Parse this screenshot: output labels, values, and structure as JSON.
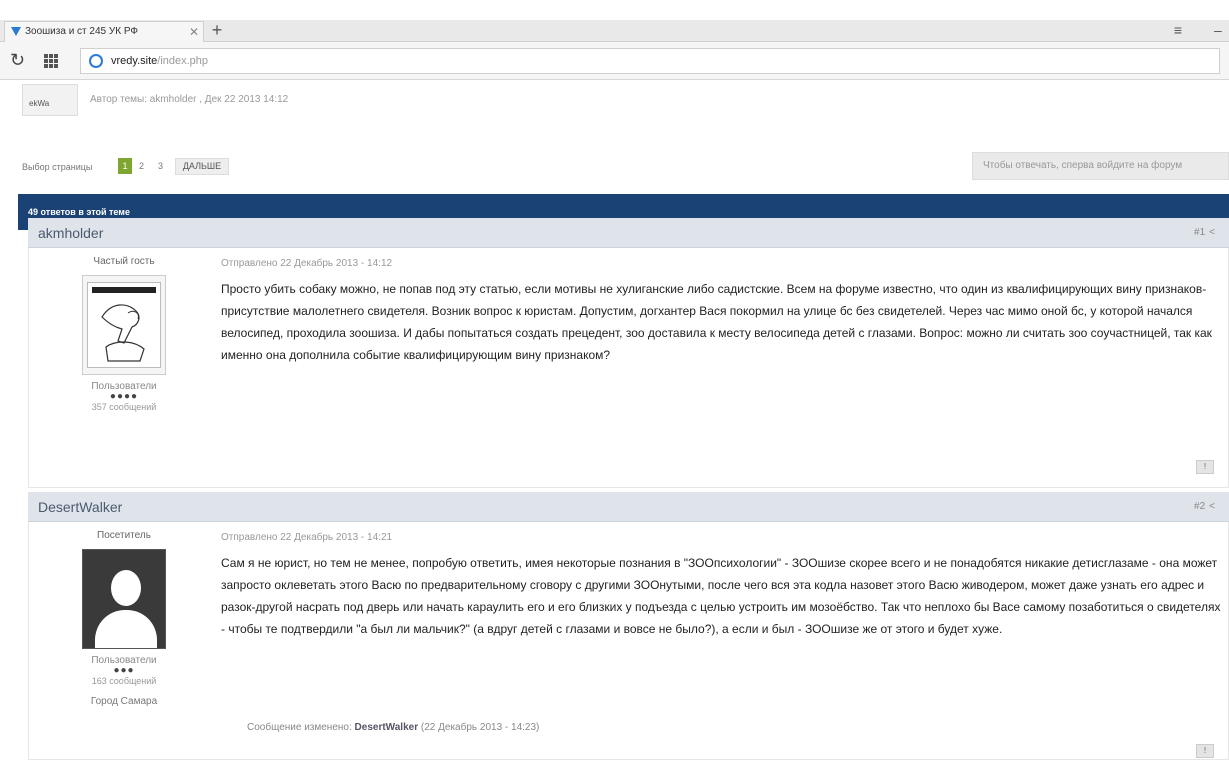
{
  "browser": {
    "tab_title": "Зоошиза и ст 245 УК РФ",
    "tab_close": "✕",
    "new_tab": "+",
    "menu_icon": "≡",
    "url_site": "vredy.site",
    "url_path": "/index.php"
  },
  "topic": {
    "author_line": "Автор темы: akmholder , Дек 22 2013 14:12"
  },
  "pager": {
    "label": "Выбор страницы",
    "pages": [
      "1",
      "2",
      "3"
    ],
    "next_label": "ДАЛЬШЕ",
    "login_hint": "Чтобы отвечать, сперва войдите на форум"
  },
  "replies_bar": "49 ответов в этой теме",
  "posts": [
    {
      "author": "akmholder",
      "number": "#1",
      "rank_title": "Частый гость",
      "group": "Пользователи",
      "pips": "●●●●",
      "post_count": "357 сообщений",
      "date": "Отправлено 22 Декабрь 2013 - 14:12",
      "text": "Просто убить собаку можно, не попав под эту статью, если мотивы не хулиганские либо садистские. Всем на форуме известно, что один из квалифицирующих вину признаков- присутствие малолетнего свидетеля. Возник вопрос к юристам. Допустим, догхантер Вася покормил на улице бс без свидетелей. Через час мимо оной бс, у которой начался велосипед, проходила зоошиза. И дабы попытаться создать прецедент, зоо доставила к месту велосипеда детей с глазами. Вопрос: можно ли считать зоо соучастницей, так как именно она дополнила событие квалифицирующим вину признаком?",
      "report": "!"
    },
    {
      "author": "DesertWalker",
      "number": "#2",
      "rank_title": "Посетитель",
      "group": "Пользователи",
      "pips": "●●●",
      "post_count": "163 сообщений",
      "city": "Город Самара",
      "date": "Отправлено 22 Декабрь 2013 - 14:21",
      "text": "Сам я не юрист, но тем не менее, попробую ответить, имея некоторые познания в \"ЗООпсихологии\" - ЗООшизе скорее всего и не понадобятся никакие детисглазаме - она может запросто оклеветать этого Васю по предварительному сговору с другими ЗООнутыми, после чего вся эта кодла назовет этого Васю живодером, может даже узнать его адрес и разок-другой насрать под дверь или начать караулить его и его близких у подъезда с целью устроить им мозоёбство. Так что неплохо бы Васе самому позаботиться о свидетелях - чтобы те подтвердили \"а был ли мальчик?\" (а вдруг детей с глазами и вовсе не было?), а если и был - ЗООшизе же от этого и будет хуже.",
      "edit_label": "Сообщение изменено:",
      "edit_author": "DesertWalker",
      "edit_date": "(22 Декабрь 2013 - 14:23)",
      "report": "!"
    }
  ]
}
